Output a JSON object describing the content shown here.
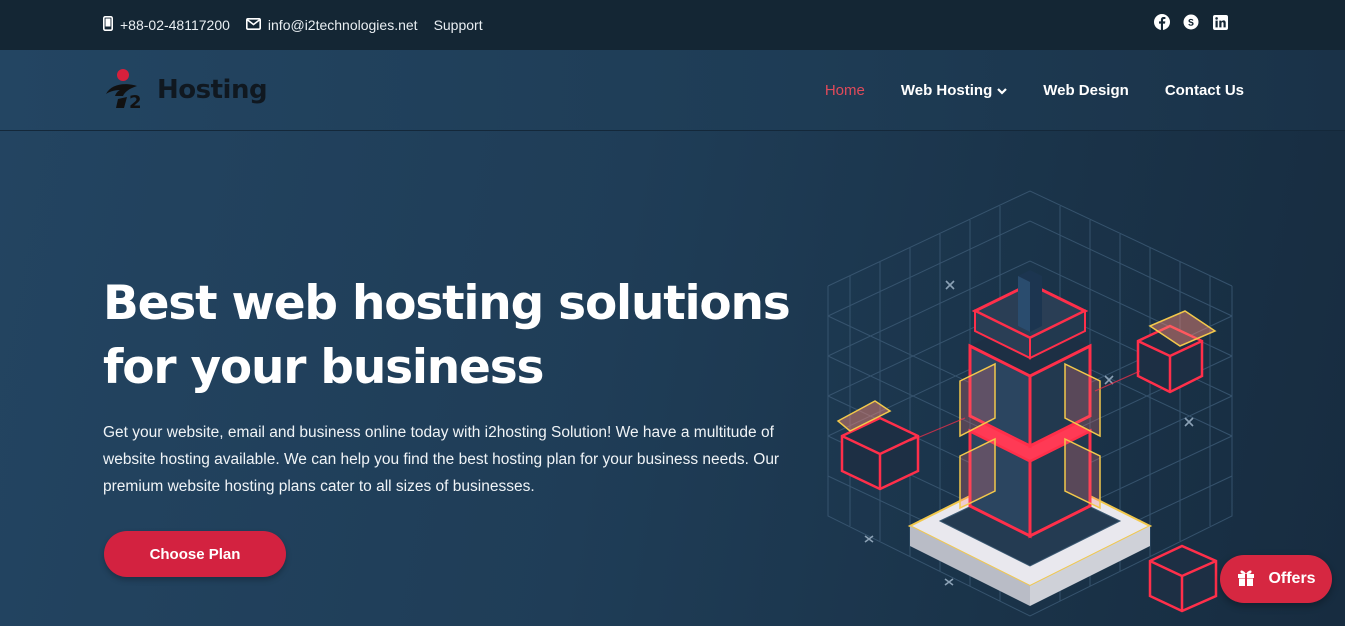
{
  "topbar": {
    "phone": "+88-02-48117200",
    "email": "info@i2technologies.net",
    "support": "Support",
    "social": [
      "facebook-icon",
      "skype-icon",
      "linkedin-icon"
    ]
  },
  "header": {
    "logo_text": "Hosting",
    "nav": [
      {
        "label": "Home",
        "active": true
      },
      {
        "label": "Web Hosting",
        "dropdown": true
      },
      {
        "label": "Web Design"
      },
      {
        "label": "Contact Us"
      }
    ]
  },
  "hero": {
    "title_line1": "Best web hosting solutions",
    "title_line2": "for your business",
    "description": "Get your website, email and business online today with i2hosting Solution! We have a multitude of website hosting available. We can help you find the best hosting plan for your business needs. Our premium website hosting plans cater to all sizes of businesses.",
    "cta_label": "Choose Plan"
  },
  "offers": {
    "label": "Offers"
  },
  "colors": {
    "accent": "#d32240",
    "active_nav": "#e04a5a",
    "topbar_bg": "#142634"
  }
}
